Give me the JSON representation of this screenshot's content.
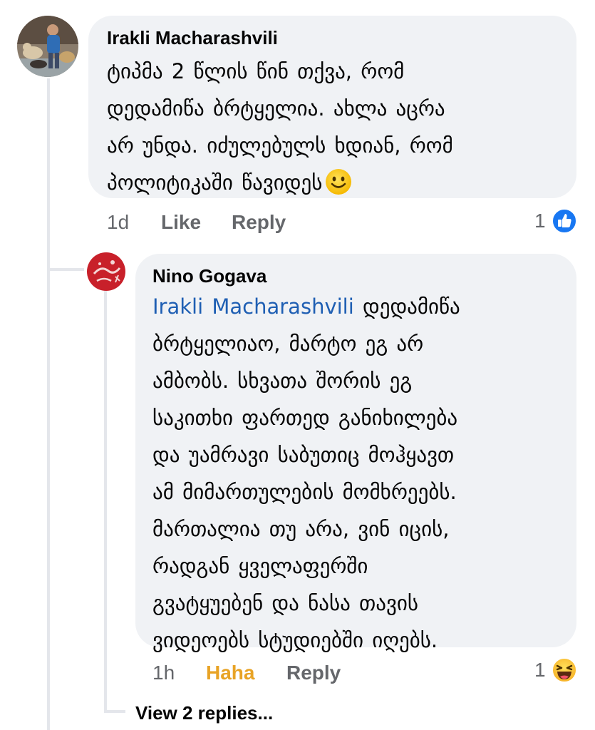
{
  "comments": [
    {
      "author": "Irakli Macharashvili",
      "lines": [
        "ტიპმა 2 წლის წინ თქვა, რომ",
        "დედამიწა ბრტყელია. ახლა აცრა",
        "არ უნდა. იძულებულს ხდიან, რომ",
        "პოლიტიკაში წავიდეს"
      ],
      "emoji": "slightly-smiling-face",
      "time": "1d",
      "action_react": "Like",
      "action_reply": "Reply",
      "reaction_count": "1",
      "reaction_icon": "like-icon"
    },
    {
      "author": "Nino Gogava",
      "mention": "Irakli Macharashvili",
      "first_line_rest": "დედამიწა",
      "lines": [
        "ბრტყელიაო, მარტო ეგ არ",
        "ამბობს. სხვათა შორის ეგ",
        "საკითხი ფართედ განიხილება",
        "და უამრავი საბუთიც მოჰყავთ",
        "ამ მიმართულების მომხრეებს.",
        "მართალია თუ არა, ვინ იცის,",
        "რადგან  ყველაფერში",
        "გვატყუებენ და ნასა თავის",
        "ვიდეოებს სტუდიებში იღებს."
      ],
      "time": "1h",
      "action_react": "Haha",
      "action_reply": "Reply",
      "reaction_count": "1",
      "reaction_icon": "haha-icon"
    }
  ],
  "view_replies": "View 2 replies...",
  "colors": {
    "bubble": "#f0f2f5",
    "mention": "#1f5fb3",
    "meta": "#65676b",
    "haha": "#e8a325",
    "like_blue": "#1877f2"
  }
}
